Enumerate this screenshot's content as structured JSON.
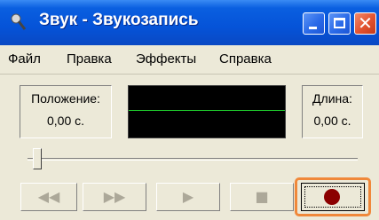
{
  "window": {
    "title": "Звук - Звукозапись"
  },
  "menu": [
    "Файл",
    "Правка",
    "Эффекты",
    "Справка"
  ],
  "position": {
    "label": "Положение:",
    "value": "0,00 с."
  },
  "length": {
    "label": "Длина:",
    "value": "0,00 с."
  },
  "slider": {
    "value": 0
  },
  "controls": {
    "rewind_icon": "◀◀",
    "forward_icon": "▶▶",
    "play_icon": "▶",
    "stop_icon": "■"
  },
  "colors": {
    "record": "#8b0000",
    "wave": "#1fcc2d",
    "highlight": "#f0883a"
  }
}
